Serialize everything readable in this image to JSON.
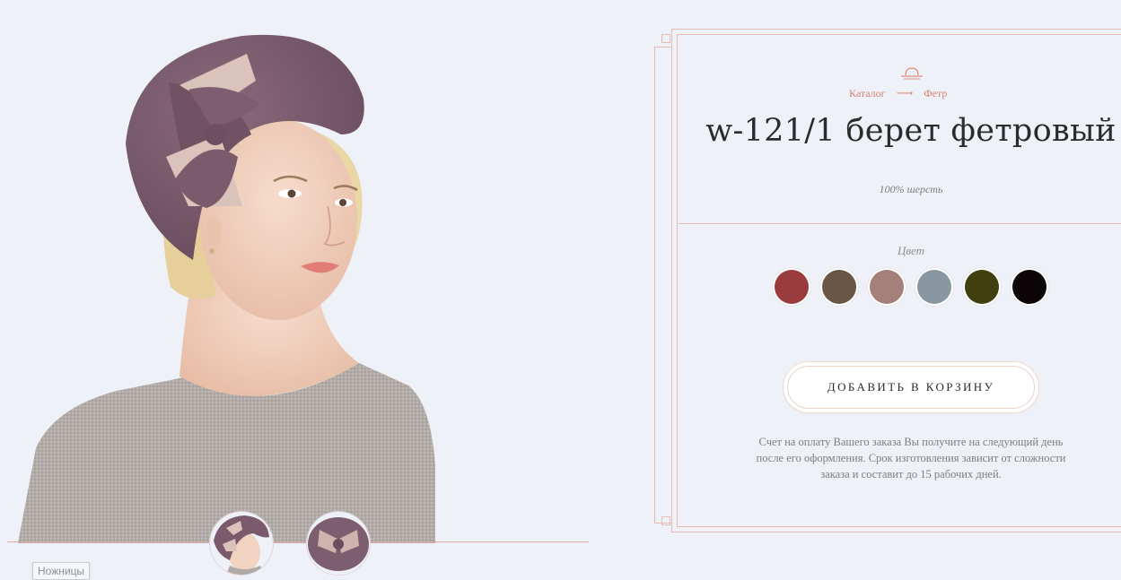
{
  "breadcrumb": {
    "catalog": "Каталог",
    "arrow": "⟶",
    "current": "Фетр"
  },
  "product": {
    "title": "w-121/1 берет фетровый",
    "material": "100% шерсть",
    "color_label": "Цвет",
    "add_to_cart": "ДОБАВИТЬ В КОРЗИНУ",
    "note": "Счет на оплату Вашего заказа Вы получите на следующий день после его оформления. Срок изготовления зависит от сложности заказа и составит до 15 рабочих дней."
  },
  "colors": [
    "#9a3b3e",
    "#6a5646",
    "#a57f79",
    "#8997a2",
    "#3f3f0f",
    "#0c0609"
  ],
  "tooltip": "Ножницы",
  "icons": {
    "brand": "hat-logo-icon"
  }
}
